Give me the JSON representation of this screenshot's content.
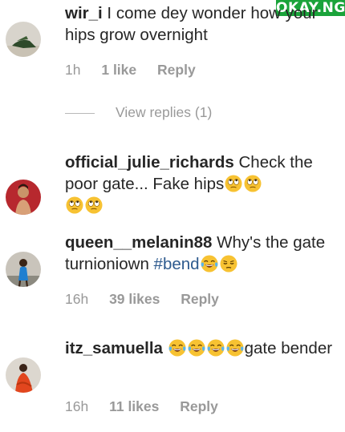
{
  "watermark": {
    "text": "OKAY.NG",
    "color": "#1aa33a"
  },
  "comments": [
    {
      "username": "wir_i",
      "text": "I come dey wonder how your hips grow overnight",
      "time": "1h",
      "likes": "1 like",
      "reply": "Reply"
    },
    {
      "username": "official_julie_richards",
      "text": "Check the poor gate... Fake hips",
      "emoji": [
        "rolling-eyes-emoji",
        "rolling-eyes-emoji",
        "rolling-eyes-emoji",
        "rolling-eyes-emoji"
      ]
    },
    {
      "username": "queen__melanin88",
      "text": "Why's the gate turnioniown",
      "hashtag": "#bend",
      "emoji": [
        "tears-of-joy-emoji",
        "unamused-emoji"
      ],
      "time": "16h",
      "likes": "39 likes",
      "reply": "Reply"
    },
    {
      "username": "itz_samuella",
      "emoji": [
        "tears-of-joy-emoji",
        "tears-of-joy-emoji",
        "tears-of-joy-emoji",
        "tears-of-joy-emoji"
      ],
      "text": "gate bender",
      "time": "16h",
      "likes": "11 likes",
      "reply": "Reply"
    }
  ],
  "view_replies": "View replies (1)",
  "colors": {
    "text": "#262626",
    "meta": "#999999",
    "hashtag": "#2d5a8e",
    "emoji_face": "#f7c232"
  }
}
